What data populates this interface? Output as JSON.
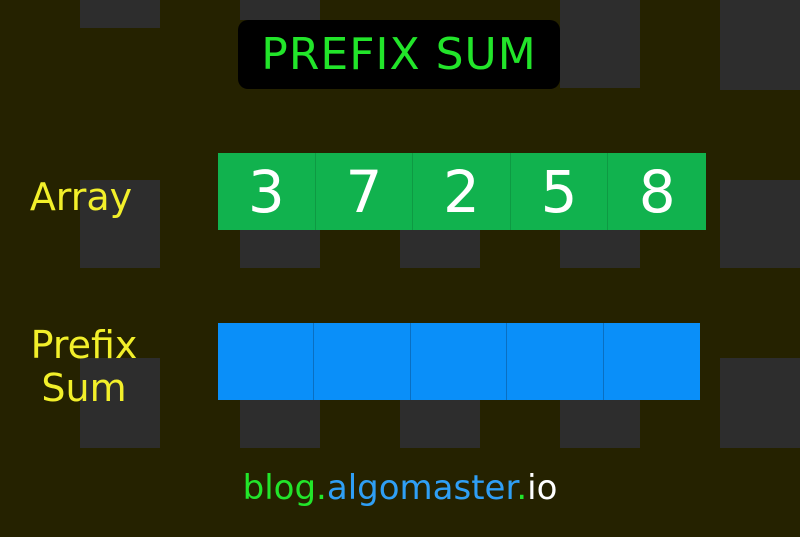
{
  "title": "PREFIX SUM",
  "array": {
    "label": "Array",
    "values": [
      "3",
      "7",
      "2",
      "5",
      "8"
    ]
  },
  "prefix": {
    "label_line1": "Prefix",
    "label_line2": "Sum",
    "values": [
      "",
      "",
      "",
      "",
      ""
    ]
  },
  "footer": {
    "part1": "blog.",
    "part2": "algomaster",
    "part3": ".",
    "part4": "io"
  },
  "colors": {
    "title": "#22e52a",
    "label": "#f2ef2a",
    "array_cell": "#11b24e",
    "prefix_cell": "#0a8ff9",
    "footer_green": "#22e52a",
    "footer_blue": "#2f9ff5",
    "footer_white": "#ffffff"
  }
}
